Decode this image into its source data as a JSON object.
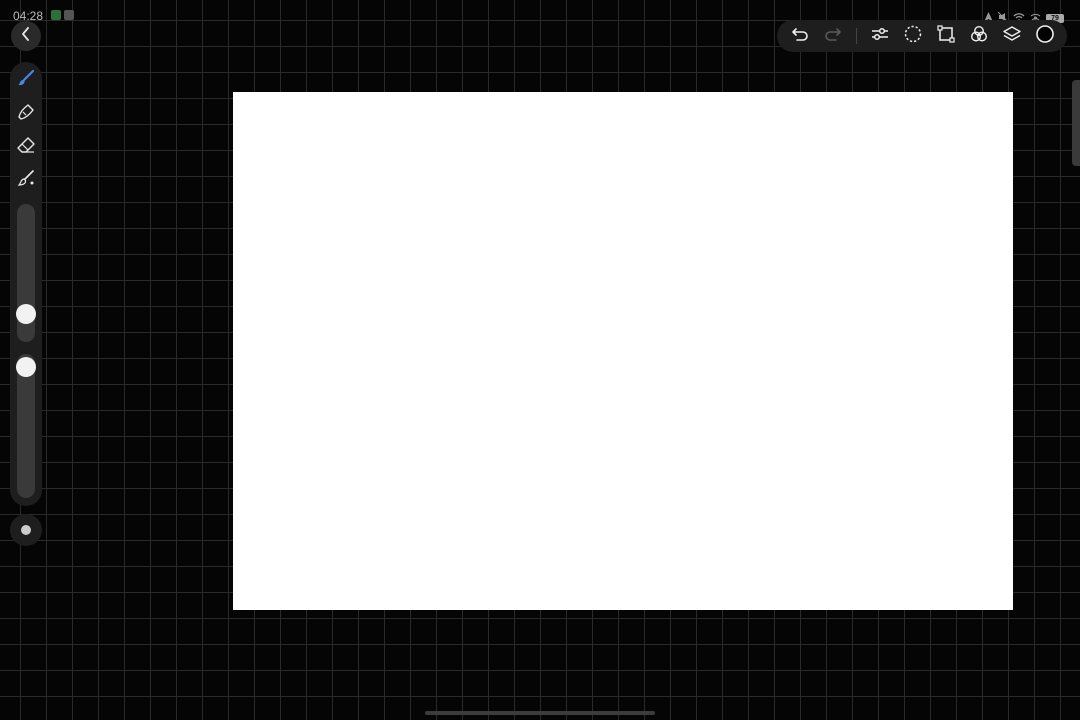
{
  "status_bar": {
    "time": "04:28",
    "battery": "79"
  },
  "icons": {
    "back": "chevron-left-icon",
    "undo": "undo-icon",
    "redo": "redo-icon",
    "adjustments": "sliders-icon",
    "selection": "lasso-select-icon",
    "transform": "transform-icon",
    "blend": "blend-circles-icon",
    "layers": "layers-icon",
    "color": "color-circle-icon",
    "brush": "brush-icon",
    "smudge": "smudge-icon",
    "eraser": "eraser-icon",
    "fill": "fill-brush-icon"
  },
  "colors": {
    "active_tool": "#4a86e8",
    "current_color": "#000000",
    "canvas": "#ffffff"
  },
  "sliders": {
    "brush_size": 0.7,
    "brush_opacity": 0.1
  }
}
